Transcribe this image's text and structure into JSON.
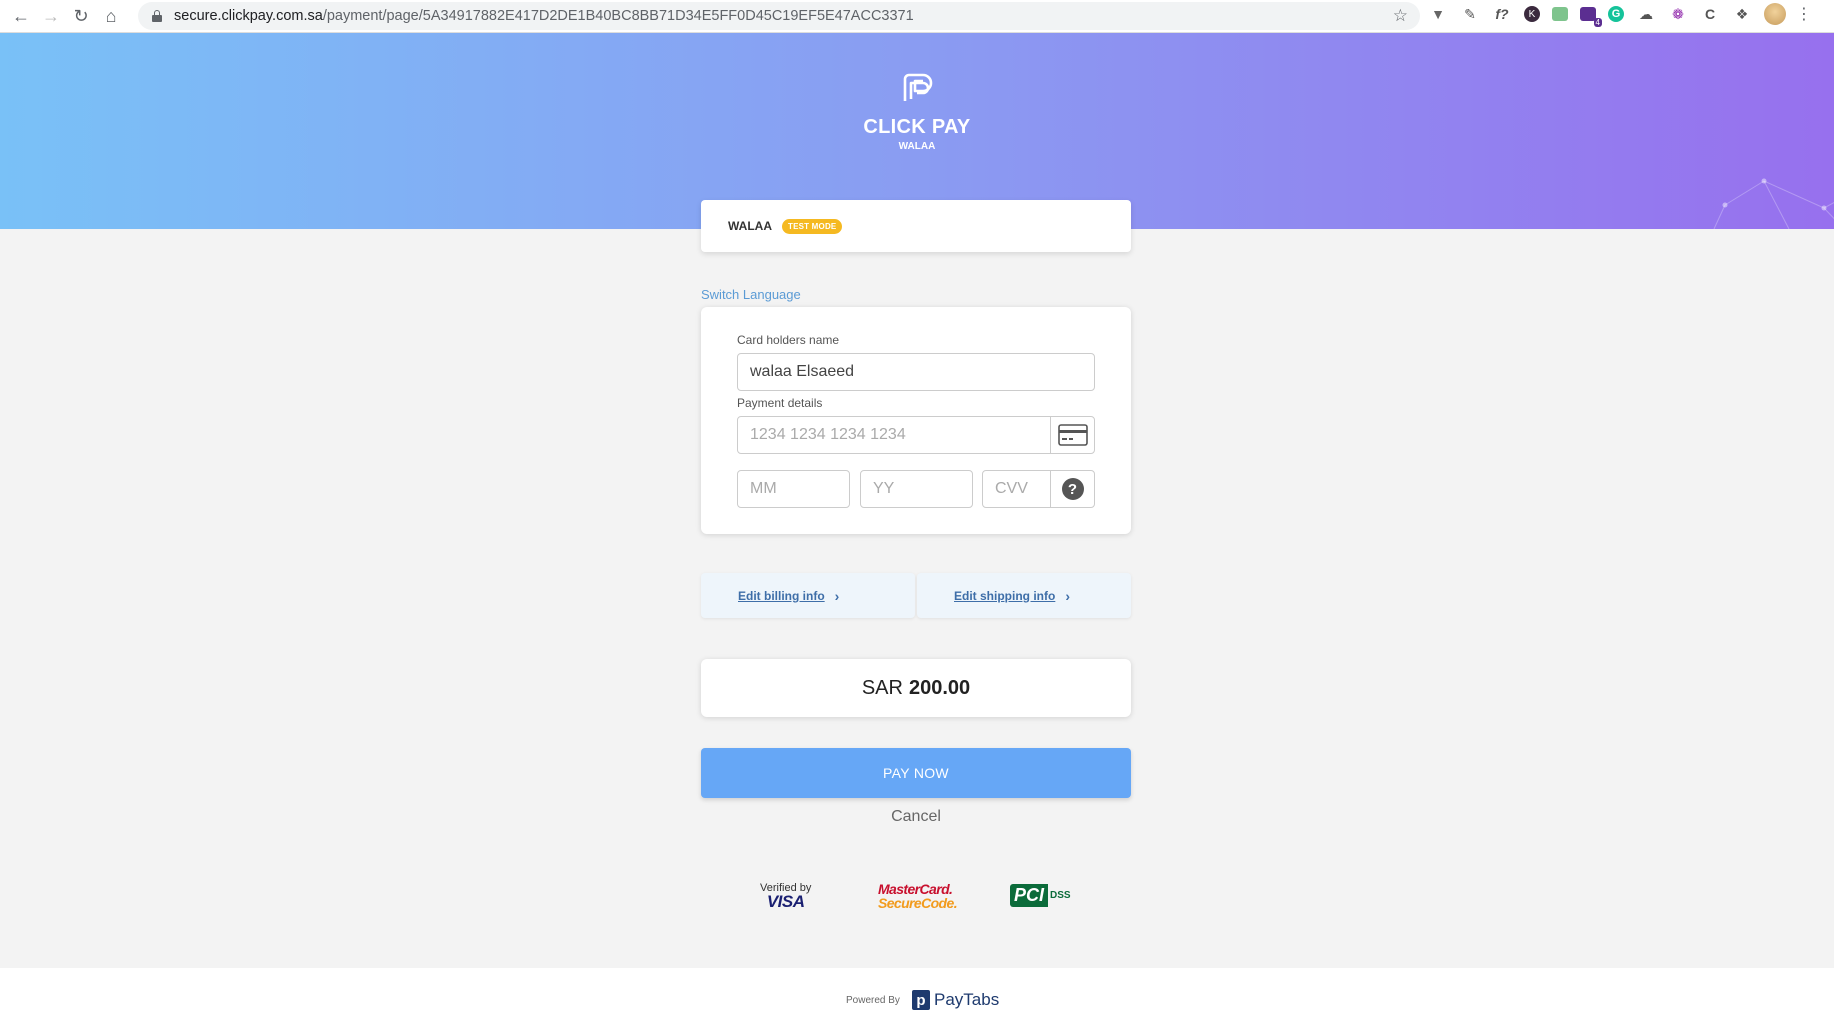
{
  "browser": {
    "url_host": "secure.clickpay.com.sa",
    "url_path": "/payment/page/5A34917882E417D2DE1B40BC8BB71D34E5FF0D45C19EF5E47ACC3371",
    "extension_badge": "4"
  },
  "header": {
    "brand_name": "CLICK PAY",
    "brand_sub": "WALAA"
  },
  "merchant": {
    "name": "WALAA",
    "badge": "TEST MODE"
  },
  "switch_language": "Switch Language",
  "form": {
    "holder_label": "Card holders name",
    "holder_value": "walaa Elsaeed",
    "payment_label": "Payment details",
    "card_placeholder": "1234 1234 1234 1234",
    "mm_placeholder": "MM",
    "yy_placeholder": "YY",
    "cvv_placeholder": "CVV",
    "help_glyph": "?"
  },
  "edit": {
    "billing": "Edit billing info",
    "shipping": "Edit shipping info"
  },
  "amount": {
    "currency": "SAR",
    "value": "200.00"
  },
  "pay_button": "PAY NOW",
  "cancel": "Cancel",
  "trust": {
    "visa_line1": "Verified by",
    "visa_line2": "VISA",
    "mc_line1": "MasterCard.",
    "mc_line2": "SecureCode.",
    "pci_line1": "PCI",
    "pci_line2": "DSS"
  },
  "footer": {
    "powered_by": "Powered By",
    "provider": "PayTabs"
  },
  "colors": {
    "header_start": "#79c1f7",
    "header_end": "#9770ee",
    "pay_button": "#66a7f6",
    "badge": "#f5b921",
    "link": "#3e6ea8"
  }
}
